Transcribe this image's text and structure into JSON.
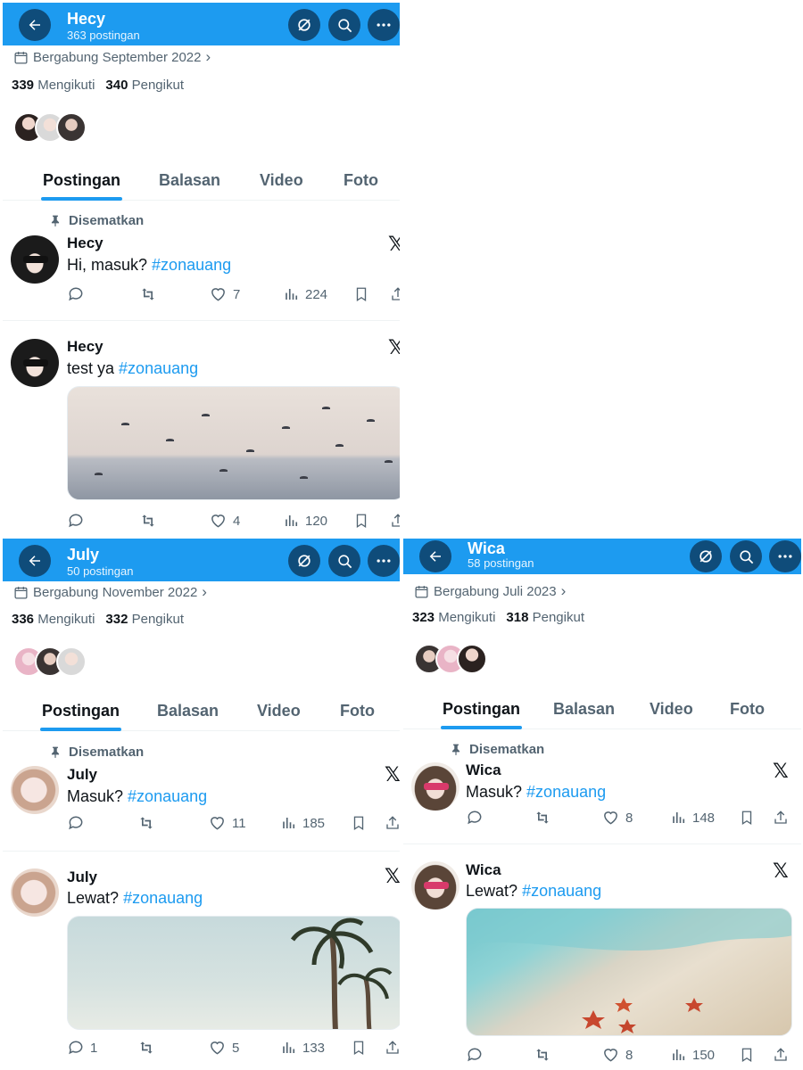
{
  "icons": {
    "back": "arrow-left-icon",
    "grok": "grok-icon",
    "search": "search-icon",
    "more": "more-icon",
    "calendar": "calendar-icon",
    "pin": "pin-icon",
    "reply": "reply-icon",
    "repost": "repost-icon",
    "like": "heart-icon",
    "views": "views-icon",
    "bookmark": "bookmark-icon",
    "share": "share-icon",
    "x": "x-logo-icon"
  },
  "colors": {
    "accent": "#1d9bf0",
    "header": "#1d9bf0",
    "muted": "#536471",
    "text": "#0f1419"
  },
  "panels": {
    "hecy": {
      "header": {
        "name": "Hecy",
        "posts": "363 postingan"
      },
      "joined": "Bergabung September 2022",
      "following": {
        "count": "339",
        "label": "Mengikuti"
      },
      "followers": {
        "count": "340",
        "label": "Pengikut"
      },
      "tabs": [
        "Postingan",
        "Balasan",
        "Video",
        "Foto"
      ],
      "pinned_label": "Disematkan",
      "posts": [
        {
          "name": "Hecy",
          "text": "Hi, masuk?",
          "tag": "#zonauang",
          "likes": "7",
          "views": "224"
        },
        {
          "name": "Hecy",
          "text": "test ya",
          "tag": "#zonauang",
          "likes": "4",
          "views": "120"
        }
      ]
    },
    "july": {
      "header": {
        "name": "July",
        "posts": "50 postingan"
      },
      "joined": "Bergabung November 2022",
      "following": {
        "count": "336",
        "label": "Mengikuti"
      },
      "followers": {
        "count": "332",
        "label": "Pengikut"
      },
      "tabs": [
        "Postingan",
        "Balasan",
        "Video",
        "Foto"
      ],
      "pinned_label": "Disematkan",
      "posts": [
        {
          "name": "July",
          "text": "Masuk?",
          "tag": "#zonauang",
          "replies": "",
          "likes": "11",
          "views": "185"
        },
        {
          "name": "July",
          "text": "Lewat?",
          "tag": "#zonauang",
          "replies": "1",
          "likes": "5",
          "views": "133"
        }
      ]
    },
    "wica": {
      "header": {
        "name": "Wica",
        "posts": "58 postingan"
      },
      "joined": "Bergabung Juli 2023",
      "following": {
        "count": "323",
        "label": "Mengikuti"
      },
      "followers": {
        "count": "318",
        "label": "Pengikut"
      },
      "tabs": [
        "Postingan",
        "Balasan",
        "Video",
        "Foto"
      ],
      "pinned_label": "Disematkan",
      "posts": [
        {
          "name": "Wica",
          "text": "Masuk?",
          "tag": "#zonauang",
          "likes": "8",
          "views": "148"
        },
        {
          "name": "Wica",
          "text": "Lewat?",
          "tag": "#zonauang",
          "likes": "8",
          "views": "150"
        }
      ]
    }
  }
}
